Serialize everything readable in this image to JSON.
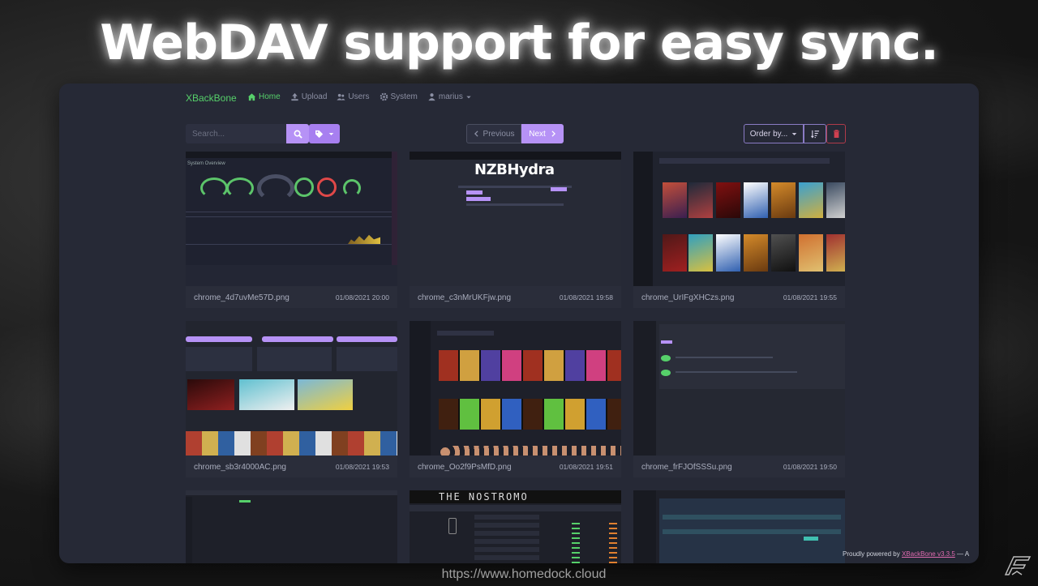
{
  "headline": "WebDAV support for easy sync.",
  "app": {
    "brand": "XBackBone",
    "nav": [
      {
        "label": "Home",
        "icon": "home-icon"
      },
      {
        "label": "Upload",
        "icon": "upload-icon"
      },
      {
        "label": "Users",
        "icon": "users-icon"
      },
      {
        "label": "System",
        "icon": "gear-icon"
      },
      {
        "label": "marius",
        "icon": "user-icon"
      }
    ],
    "search_placeholder": "Search...",
    "prev_label": "Previous",
    "next_label": "Next",
    "order_label": "Order by...",
    "accent": "#b692f6",
    "brand_color": "#56d06a"
  },
  "cards": [
    {
      "filename": "chrome_4d7uvMe57D.png",
      "date": "01/08/2021 20:00"
    },
    {
      "filename": "chrome_c3nMrUKFjw.png",
      "date": "01/08/2021 19:58"
    },
    {
      "filename": "chrome_UrIFgXHCzs.png",
      "date": "01/08/2021 19:55"
    },
    {
      "filename": "chrome_sb3r4000AC.png",
      "date": "01/08/2021 19:53"
    },
    {
      "filename": "chrome_Oo2f9PsMfD.png",
      "date": "01/08/2021 19:51"
    },
    {
      "filename": "chrome_frFJOfSSSu.png",
      "date": "01/08/2021 19:50"
    }
  ],
  "thumb_texts": {
    "system_overview": "System Overview",
    "nzb_logo": "NZBHydra",
    "nostromo": "THE NOSTROMO"
  },
  "footer": {
    "prefix": "Proudly powered by",
    "link": "XBackBone v3.3.5",
    "suffix": "— A"
  },
  "url": "https://www.homedock.cloud"
}
